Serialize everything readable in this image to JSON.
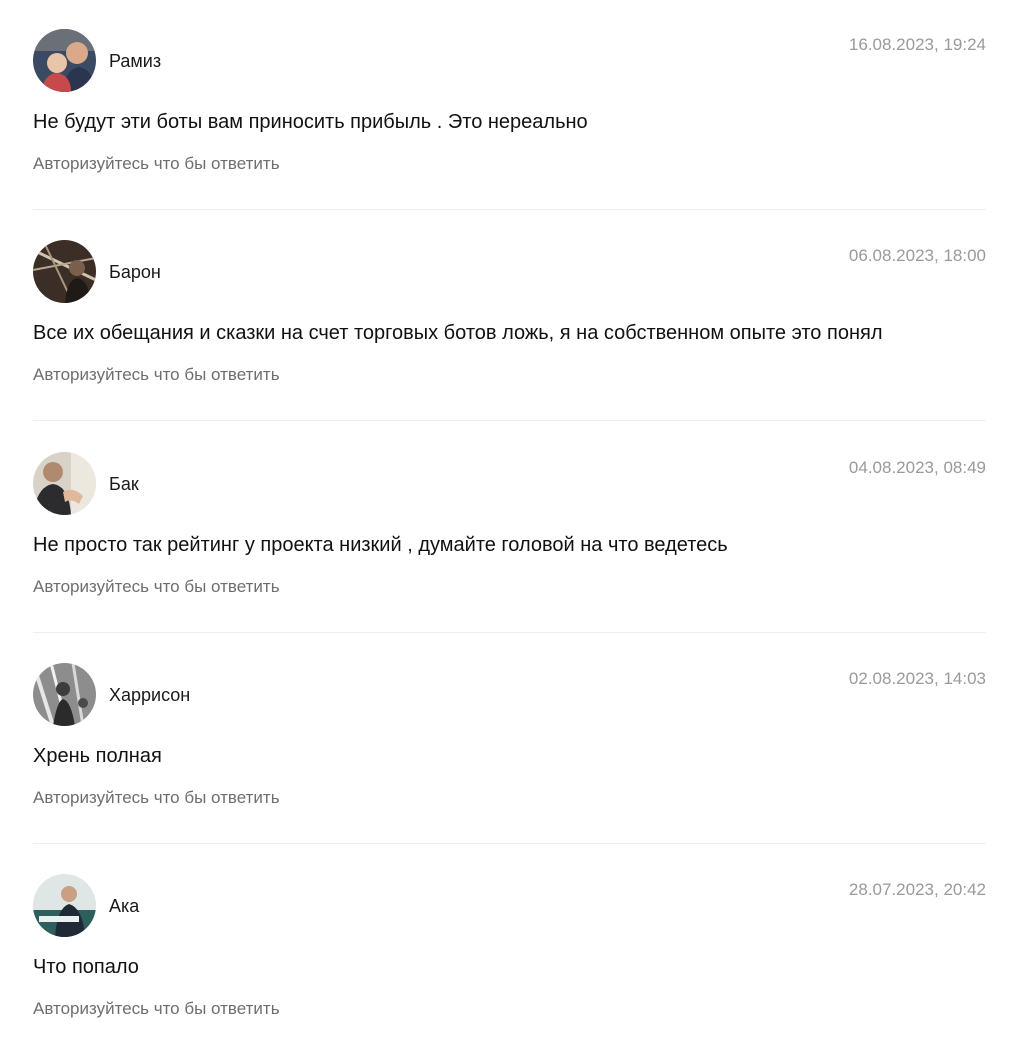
{
  "comments": [
    {
      "author": "Рамиз",
      "date": "16.08.2023, 19:24",
      "text": "Не будут эти боты вам приносить прибыль . Это нереально",
      "reply_label": "Авторизуйтесь что бы ответить"
    },
    {
      "author": "Барон",
      "date": "06.08.2023, 18:00",
      "text": "Все их обещания и сказки на счет торговых ботов ложь, я на собственном опыте это понял",
      "reply_label": "Авторизуйтесь что бы ответить"
    },
    {
      "author": "Бак",
      "date": "04.08.2023, 08:49",
      "text": "Не просто так рейтинг у проекта низкий , думайте головой на что ведетесь",
      "reply_label": "Авторизуйтесь что бы ответить"
    },
    {
      "author": "Харрисон",
      "date": "02.08.2023, 14:03",
      "text": "Хрень полная",
      "reply_label": "Авторизуйтесь что бы ответить"
    },
    {
      "author": "Ака",
      "date": "28.07.2023, 20:42",
      "text": "Что попало",
      "reply_label": "Авторизуйтесь что бы ответить"
    }
  ],
  "colors": {
    "author": "#1a1a1a",
    "date": "#9a9a9a",
    "text": "#111111",
    "reply_link": "#6e6e6e",
    "divider": "#eeeeee"
  }
}
